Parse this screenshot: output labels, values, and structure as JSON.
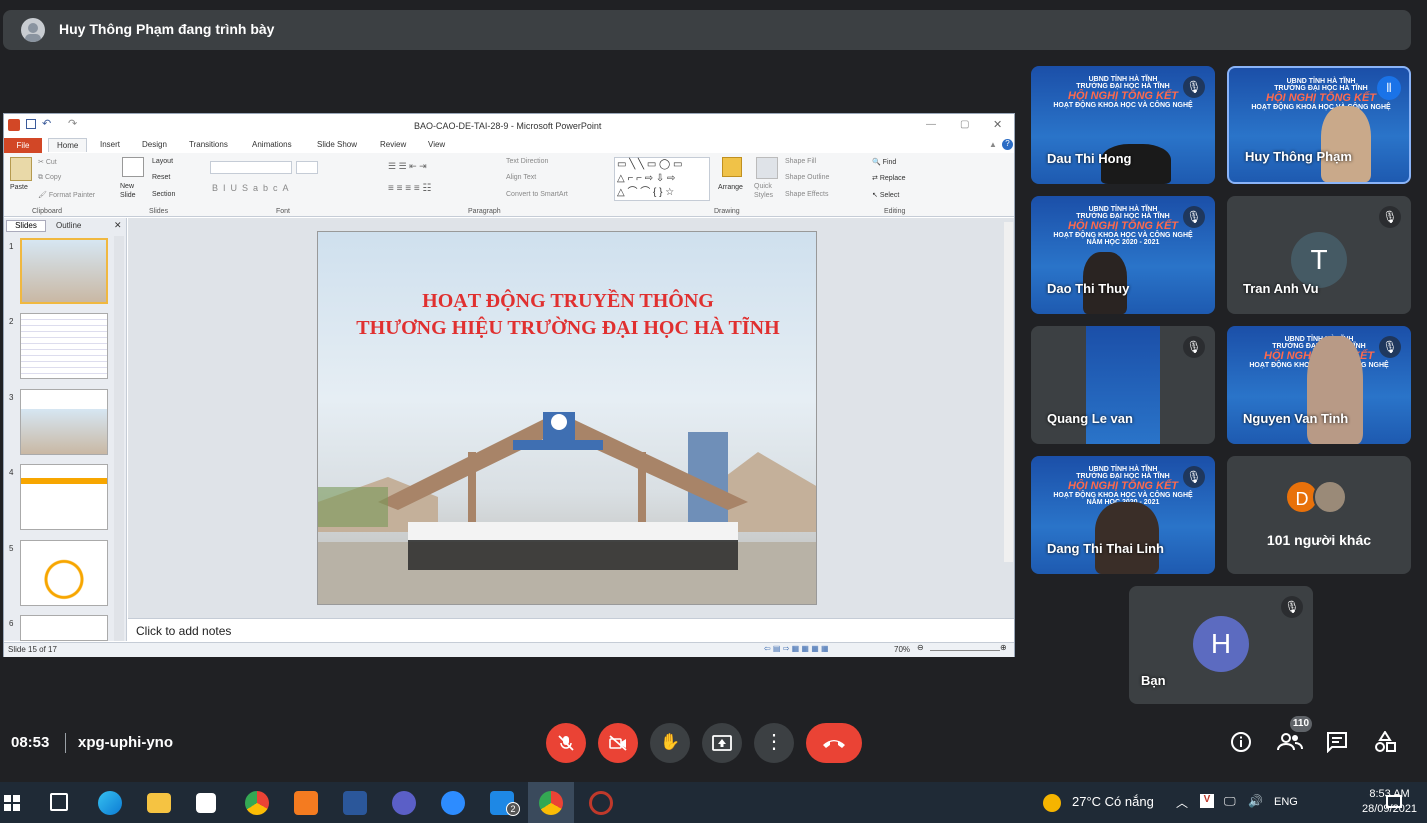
{
  "presenter": {
    "text": "Huy Thông Phạm đang trình bày"
  },
  "ppt": {
    "window_title": "BAO-CAO-DE-TAI-28-9  -  Microsoft PowerPoint",
    "file_tab": "File",
    "tabs": [
      "Home",
      "Insert",
      "Design",
      "Transitions",
      "Animations",
      "Slide Show",
      "Review",
      "View"
    ],
    "ribbon": {
      "clipboard": {
        "label": "Clipboard",
        "paste": "Paste",
        "cut": "Cut",
        "copy": "Copy",
        "format_painter": "Format Painter"
      },
      "slides": {
        "label": "Slides",
        "new_slide": "New Slide",
        "layout": "Layout",
        "reset": "Reset",
        "section": "Section"
      },
      "font": {
        "label": "Font"
      },
      "paragraph": {
        "label": "Paragraph",
        "text_direction": "Text Direction",
        "align_text": "Align Text",
        "convert": "Convert to SmartArt"
      },
      "drawing": {
        "label": "Drawing",
        "arrange": "Arrange",
        "quick_styles": "Quick Styles",
        "shape_fill": "Shape Fill",
        "shape_outline": "Shape Outline",
        "shape_effects": "Shape Effects"
      },
      "editing": {
        "label": "Editing",
        "find": "Find",
        "replace": "Replace",
        "select": "Select"
      }
    },
    "pane_tabs": {
      "slides": "Slides",
      "outline": "Outline"
    },
    "thumb_numbers": [
      "1",
      "2",
      "3",
      "4",
      "5",
      "6"
    ],
    "slide_title": [
      "HOẠT ĐỘNG TRUYỀN THÔNG",
      "THƯƠNG HIỆU TRƯỜNG ĐẠI HỌC HÀ TĨNH"
    ],
    "notes": "Click to add notes",
    "status_left": "Slide 15 of 17",
    "zoom": "70%"
  },
  "tiles": [
    {
      "name": "Dau Thi Hong",
      "style": "blue"
    },
    {
      "name": "Huy Thông Phạm",
      "style": "blue",
      "speaking": true
    },
    {
      "name": "Dao Thi Thuy",
      "style": "blue"
    },
    {
      "name": "Tran Anh Vu",
      "initial": "T",
      "style": "avatar"
    },
    {
      "name": "Quang Le van",
      "style": "blue"
    },
    {
      "name": "Nguyen Van Tinh",
      "style": "blue"
    },
    {
      "name": "Dang Thi Thai Linh",
      "style": "blue"
    },
    {
      "name": "101 người khác",
      "initial": "D",
      "style": "others"
    },
    {
      "name": "Bạn",
      "initial": "H",
      "style": "avatar"
    }
  ],
  "banner": {
    "line1": "UBND TỈNH HÀ TĨNH",
    "line2": "TRƯỜNG ĐẠI HỌC HÀ TĨNH",
    "line3": "HỘI NGHỊ TỔNG KẾT",
    "line4": "HOẠT ĐỘNG KHOA HỌC VÀ CÔNG NGHỆ",
    "line5": "NĂM HỌC 2020 - 2021"
  },
  "meeting": {
    "time": "08:53",
    "code": "xpg-uphi-yno",
    "people_count": "110"
  },
  "taskbar": {
    "temp": "27°C",
    "weather": "Có nắng",
    "lang": "ENG",
    "time": "8:53 AM",
    "date": "28/09/2021",
    "mail_badge": "2"
  },
  "colors": {
    "bg": "#202124",
    "hangup": "#ea4335",
    "accent": "#8ab4f8"
  }
}
